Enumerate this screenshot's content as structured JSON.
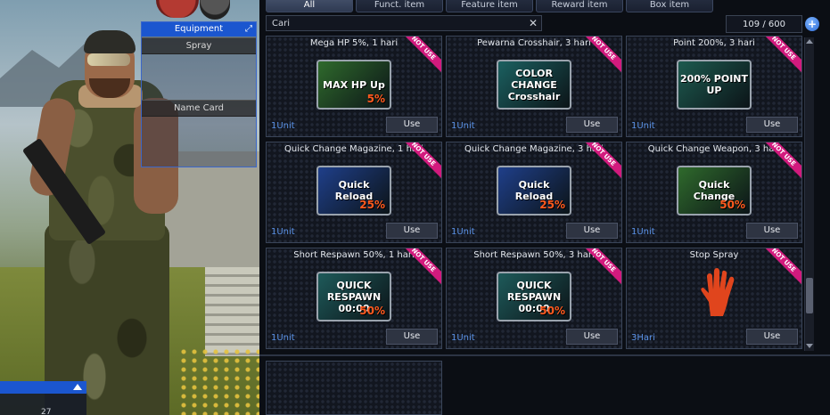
{
  "equipment": {
    "title": "Equipment",
    "slot1": "Spray",
    "slot2": "Name Card"
  },
  "chat": {
    "line": "27"
  },
  "tabs": [
    "All",
    "Funct. item",
    "Feature item",
    "Reward item",
    "Box item"
  ],
  "search": {
    "value": "Cari"
  },
  "count": "109 / 600",
  "badge": "NOT USE",
  "use_label": "Use",
  "items": [
    {
      "name": "Mega HP 5%, 1 hari",
      "qty": "1Unit",
      "art": "MAX HP Up",
      "pct": "5%",
      "color": "#2f6a2c"
    },
    {
      "name": "Pewarna Crosshair, 3 hari",
      "qty": "1Unit",
      "art": "COLOR CHANGE Crosshair",
      "pct": "",
      "color": "#1b6060"
    },
    {
      "name": "Point 200%, 3 hari",
      "qty": "1Unit",
      "art": "200% POINT UP",
      "pct": "",
      "color": "#1d5a4f"
    },
    {
      "name": "Quick Change Magazine, 1 hari",
      "qty": "1Unit",
      "art": "Quick Reload",
      "pct": "25%",
      "color": "#1f3f8a"
    },
    {
      "name": "Quick Change Magazine, 3 hari",
      "qty": "1Unit",
      "art": "Quick Reload",
      "pct": "25%",
      "color": "#1f3f8a"
    },
    {
      "name": "Quick Change Weapon, 3 hari",
      "qty": "1Unit",
      "art": "Quick Change",
      "pct": "50%",
      "color": "#2f6a2c"
    },
    {
      "name": "Short Respawn 50%, 1 hari",
      "qty": "1Unit",
      "art": "QUICK RESPAWN 00:00",
      "pct": "50%",
      "color": "#1e5a5a"
    },
    {
      "name": "Short Respawn 50%, 3 hari",
      "qty": "1Unit",
      "art": "QUICK RESPAWN 00:00",
      "pct": "50%",
      "color": "#1e5a5a"
    },
    {
      "name": "Stop Spray",
      "qty": "3Hari",
      "art": "",
      "pct": "",
      "color": "#12161f"
    }
  ]
}
